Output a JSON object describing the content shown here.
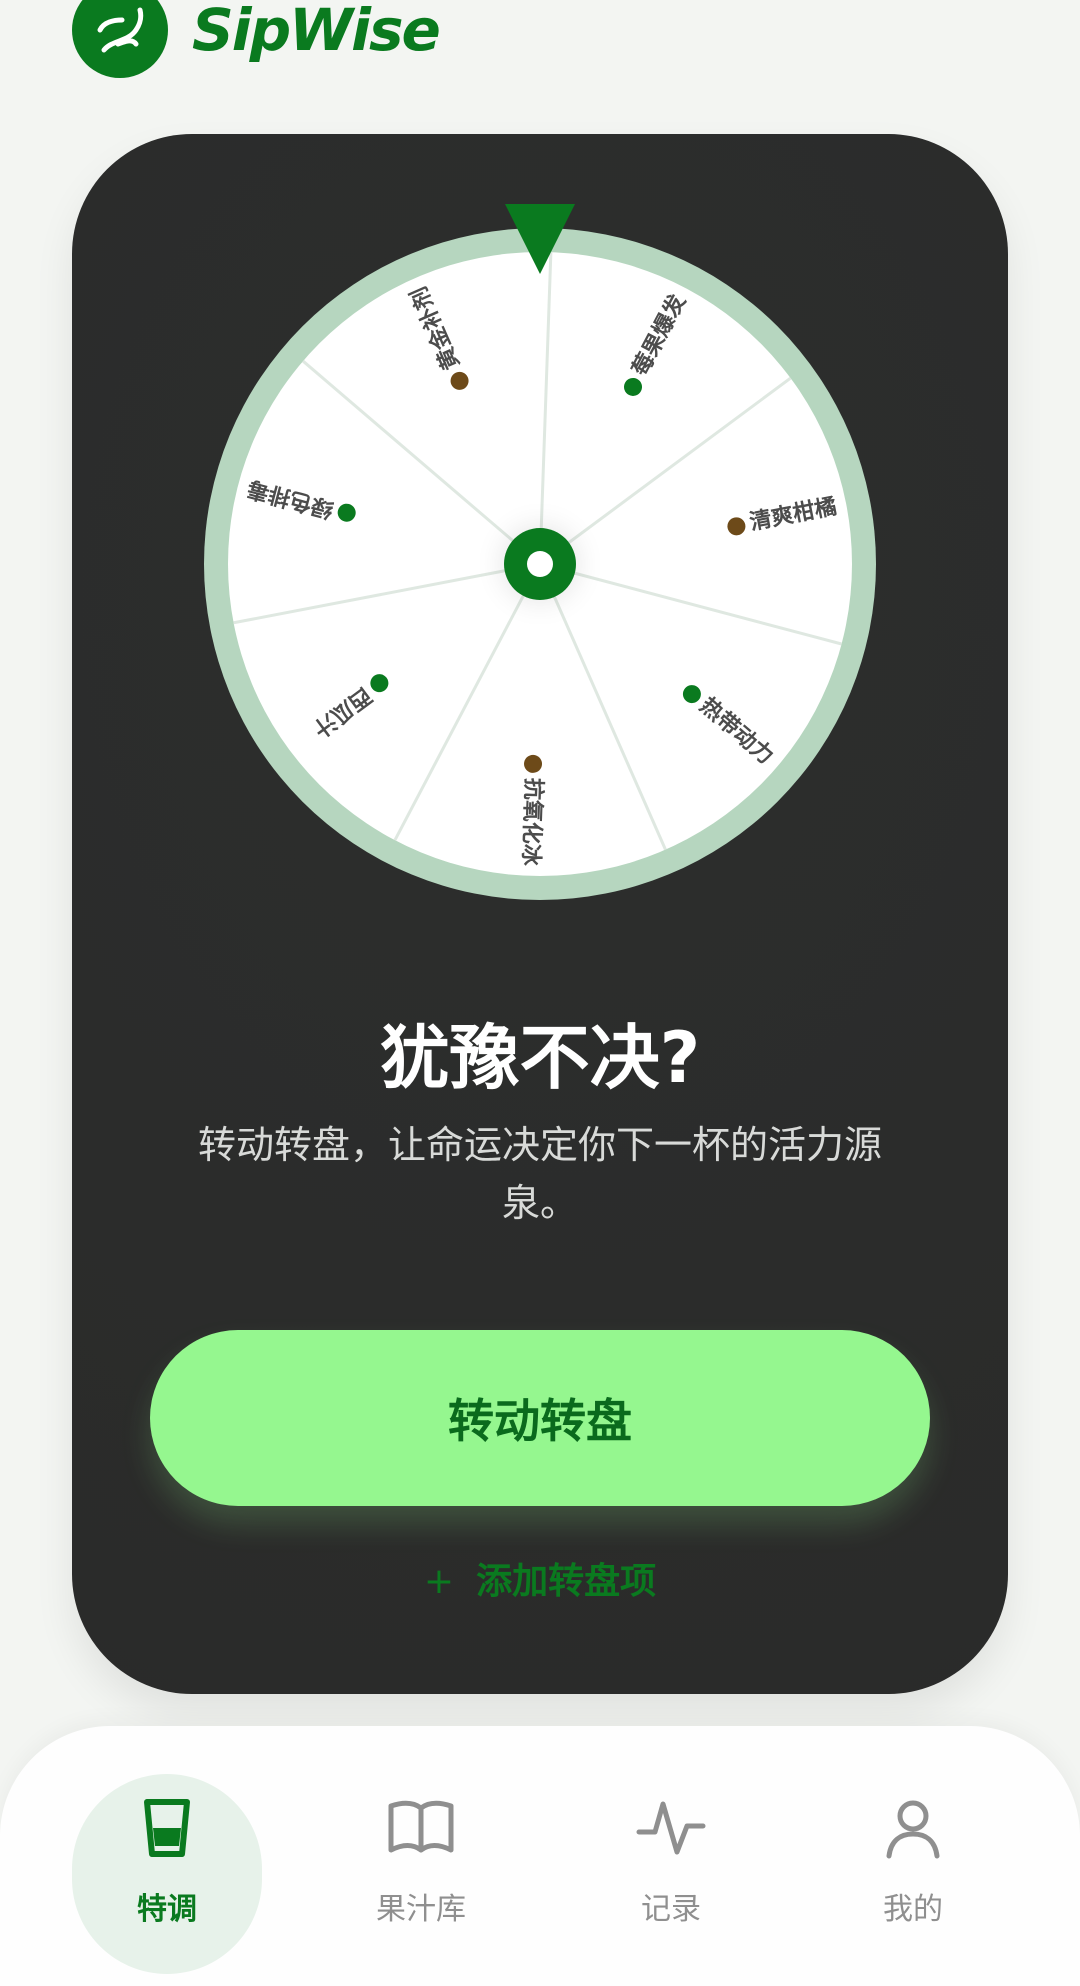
{
  "brand": {
    "name": "SipWise",
    "logo": "dna-icon"
  },
  "colors": {
    "brand_green": "#0a7a1f",
    "card_bg": "#2b2c2b",
    "wheel_ring": "#b6d6bf",
    "button_bg": "#95f78f",
    "button_text": "#0a6a1d",
    "nav_bg": "#fefefe",
    "active_bg": "#e7f2ea"
  },
  "wheel": {
    "items": [
      {
        "label": "莓果爆发",
        "dot_color": "#0a7a1f"
      },
      {
        "label": "清爽柑橘",
        "dot_color": "#6d4a19"
      },
      {
        "label": "热带动力",
        "dot_color": "#0a7a1f"
      },
      {
        "label": "抗氧化冰",
        "dot_color": "#6d4a19"
      },
      {
        "label": "西瓜汁",
        "dot_color": "#0a7a1f"
      },
      {
        "label": "绿色排毒",
        "dot_color": "#0a7a1f"
      },
      {
        "label": "黄金补剂",
        "dot_color": "#6d4a19"
      }
    ]
  },
  "main": {
    "title": "犹豫不决?",
    "subtitle": "转动转盘，让命运决定你下一杯的活力源泉。",
    "spin_button": "转动转盘",
    "add_item": "添加转盘项",
    "add_item_icon": "plus-icon"
  },
  "nav": {
    "items": [
      {
        "label": "特调",
        "icon": "cup-icon",
        "active": true
      },
      {
        "label": "果汁库",
        "icon": "book-icon",
        "active": false
      },
      {
        "label": "记录",
        "icon": "activity-icon",
        "active": false
      },
      {
        "label": "我的",
        "icon": "user-icon",
        "active": false
      }
    ]
  }
}
